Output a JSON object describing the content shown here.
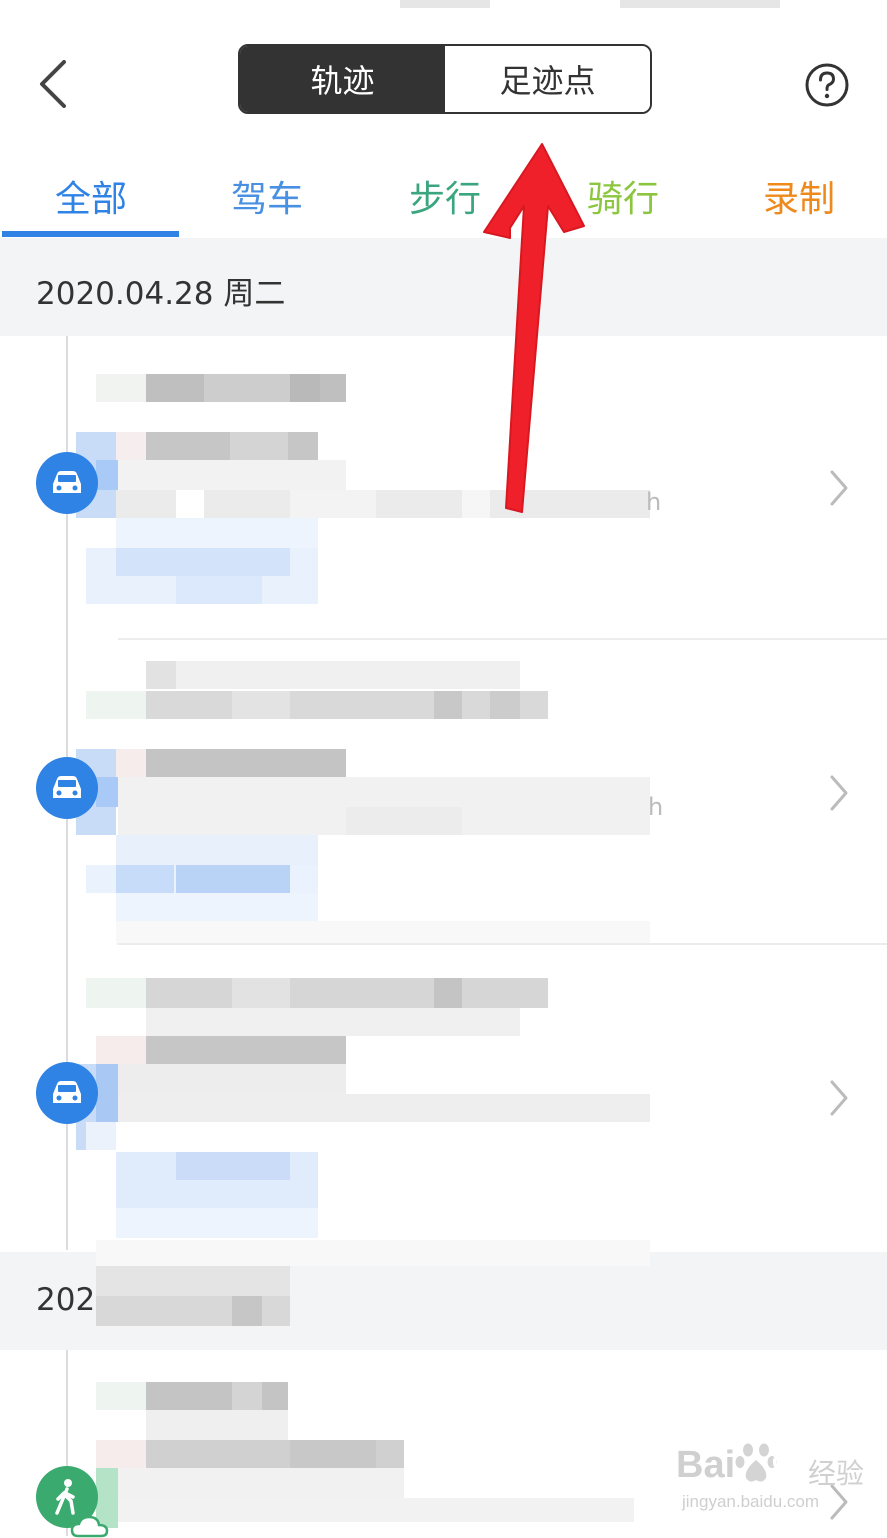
{
  "header": {
    "segments": [
      {
        "label": "轨迹",
        "active": true
      },
      {
        "label": "足迹点",
        "active": false
      }
    ]
  },
  "tabs": [
    {
      "label": "全部",
      "color": "#2f83e4",
      "active": true
    },
    {
      "label": "驾车",
      "color": "#4a90e2",
      "active": false
    },
    {
      "label": "步行",
      "color": "#3aa57e",
      "active": false
    },
    {
      "label": "骑行",
      "color": "#8cc63f",
      "active": false
    },
    {
      "label": "录制",
      "color": "#ee8a1c",
      "active": false
    }
  ],
  "sections": [
    {
      "date": "2020.04.28 周二",
      "trips": [
        {
          "mode": "car-icon",
          "color": "#2f83e4"
        },
        {
          "mode": "car-icon",
          "color": "#2f83e4"
        },
        {
          "mode": "car-icon",
          "color": "#2f83e4"
        }
      ]
    },
    {
      "date": "202",
      "trips": [
        {
          "mode": "walk-icon",
          "color": "#3aaa6e"
        }
      ]
    }
  ],
  "watermark": {
    "main": "Bai",
    "du": "du",
    "cn": "经验",
    "sub": "jingyan.baidu.com"
  },
  "colors": {
    "accent": "#2f83e4",
    "annotation_arrow": "#f0202a",
    "section_bg": "#f3f4f6"
  }
}
